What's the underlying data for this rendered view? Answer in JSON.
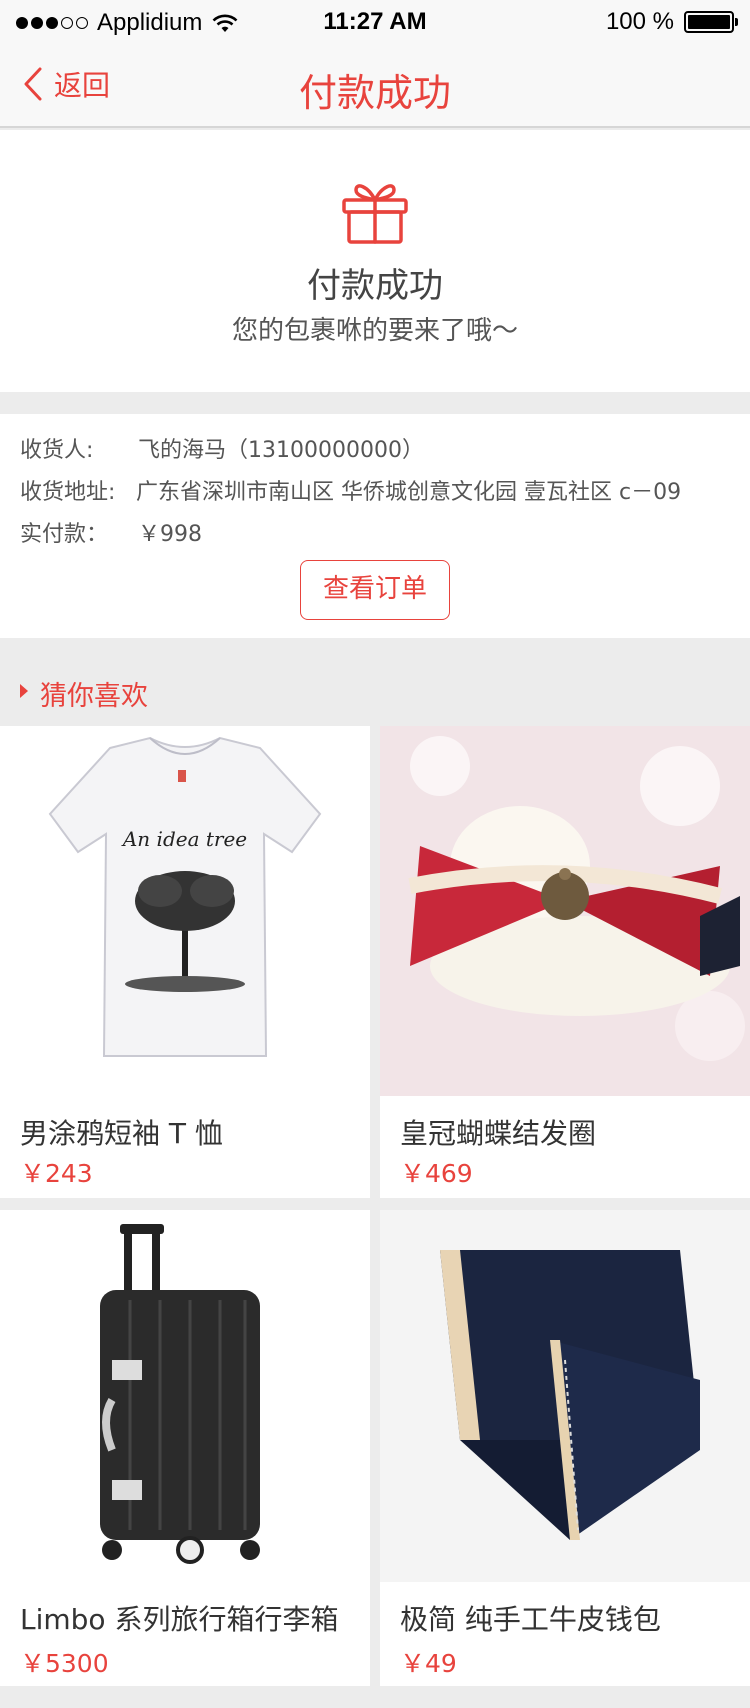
{
  "status_bar": {
    "carrier": "Applidium",
    "time": "11:27 AM",
    "battery": "100 %",
    "signal_dots_filled": 3,
    "signal_dots_total": 5
  },
  "nav": {
    "back_label": "返回",
    "title": "付款成功"
  },
  "success": {
    "icon": "gift-icon",
    "title": "付款成功",
    "subtitle": "您的包裹咻的要来了哦～"
  },
  "order": {
    "receiver_label": "收货人:",
    "receiver_value": "飞的海马（13100000000）",
    "address_label": "收货地址:",
    "address_value": "广东省深圳市南山区 华侨城创意文化园 壹瓦社区 c－09",
    "paid_label": "实付款：",
    "paid_value": "￥998",
    "view_order_button": "查看订单"
  },
  "recommend": {
    "title": "猜你喜欢",
    "items": [
      {
        "name": "男涂鸦短袖 T 恤",
        "price": "￥243",
        "image": "white-tshirt-tree-print"
      },
      {
        "name": "皇冠蝴蝶结发圈",
        "price": "￥469",
        "image": "red-bow-crown-hair-tie"
      },
      {
        "name": "Limbo 系列旅行箱行李箱",
        "price": "￥5300",
        "image": "black-suitcase"
      },
      {
        "name": "极简 纯手工牛皮钱包",
        "price": "￥49",
        "image": "navy-leather-wallet"
      }
    ]
  },
  "colors": {
    "accent": "#e8433d",
    "background": "#ececec"
  }
}
